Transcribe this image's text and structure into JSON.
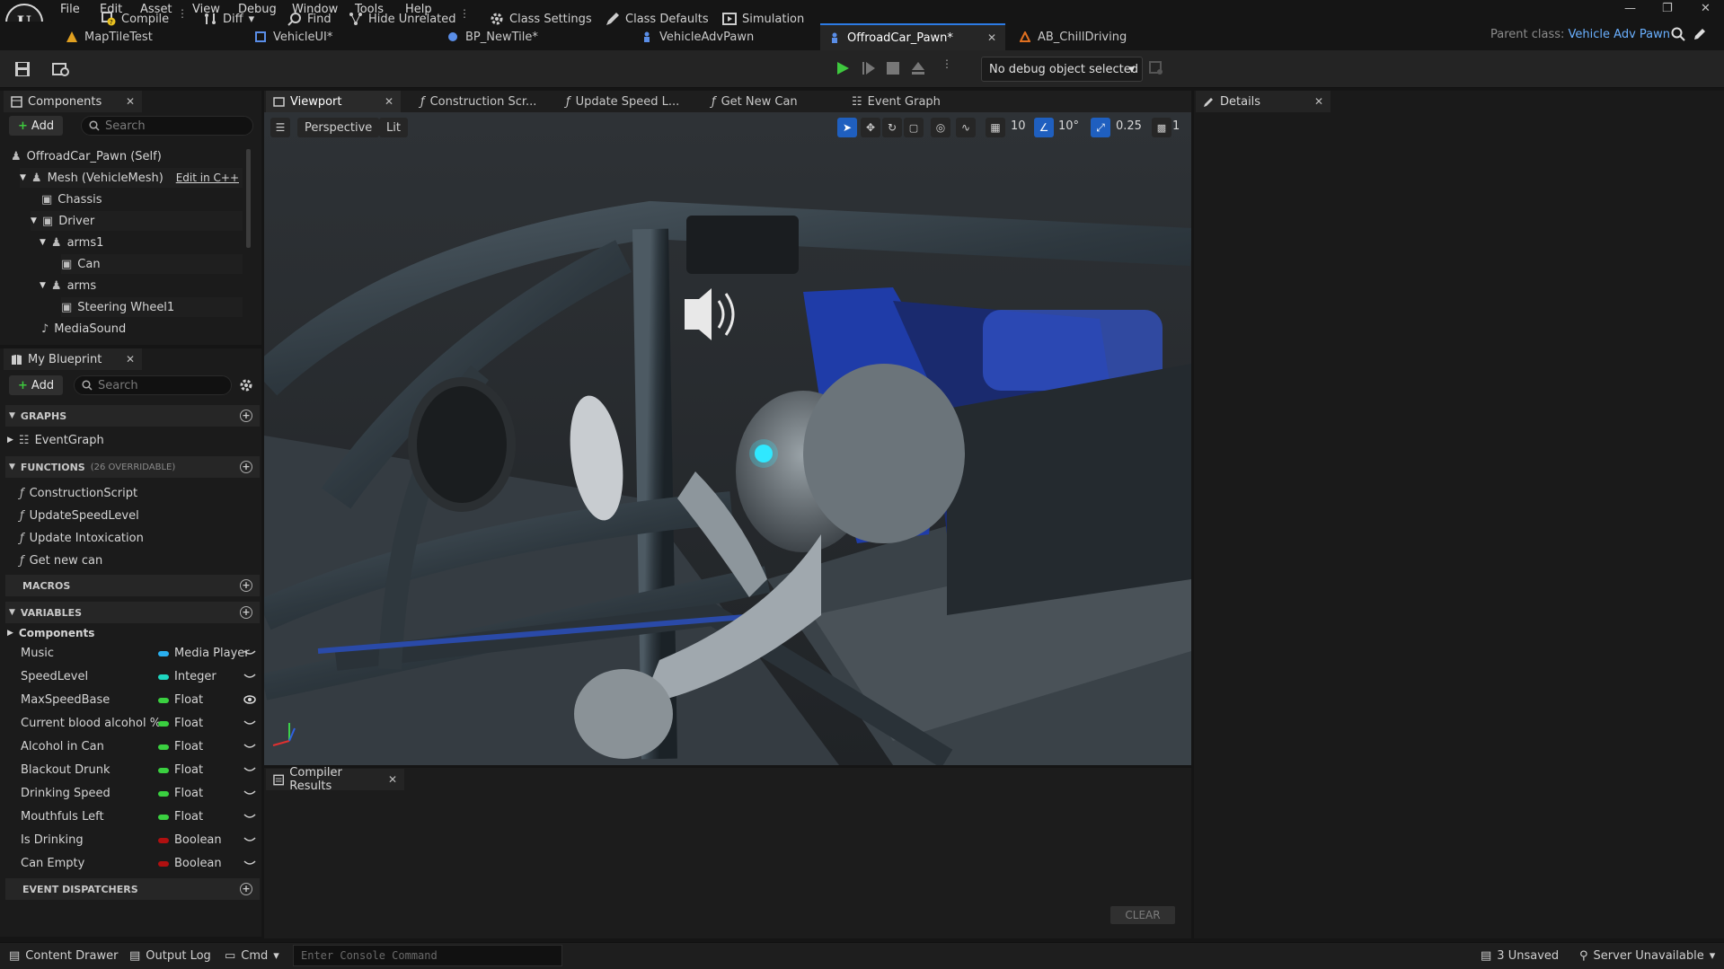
{
  "menu": [
    "File",
    "Edit",
    "Asset",
    "View",
    "Debug",
    "Window",
    "Tools",
    "Help"
  ],
  "doc_tabs": [
    {
      "label": "MapTileTest",
      "color": "#e0a020"
    },
    {
      "label": "VehicleUI*",
      "color": "#5a8ee8"
    },
    {
      "label": "BP_NewTile*",
      "color": "#5a8ee8"
    },
    {
      "label": "VehicleAdvPawn",
      "color": "#5a8ee8"
    },
    {
      "label": "OffroadCar_Pawn*",
      "color": "#5a8ee8"
    },
    {
      "label": "AB_ChillDriving",
      "color": "#e07020"
    }
  ],
  "parent_class": {
    "label": "Parent class:",
    "value": "Vehicle Adv Pawn"
  },
  "toolbar": {
    "compile": "Compile",
    "diff": "Diff",
    "find": "Find",
    "hide_unrelated": "Hide Unrelated",
    "class_settings": "Class Settings",
    "class_defaults": "Class Defaults",
    "simulation": "Simulation",
    "debug_object": "No debug object selected"
  },
  "components_panel": {
    "tab": "Components",
    "add": "Add",
    "search_placeholder": "Search",
    "tree": [
      {
        "label": "OffroadCar_Pawn (Self)",
        "indent": 0
      },
      {
        "label": "Mesh (VehicleMesh)",
        "indent": 1,
        "extra": "Edit in C++"
      },
      {
        "label": "Chassis",
        "indent": 2
      },
      {
        "label": "Driver",
        "indent": 2
      },
      {
        "label": "arms1",
        "indent": 3
      },
      {
        "label": "Can",
        "indent": 4
      },
      {
        "label": "arms",
        "indent": 3
      },
      {
        "label": "Steering Wheel1",
        "indent": 4
      },
      {
        "label": "MediaSound",
        "indent": 2
      }
    ]
  },
  "blueprint_panel": {
    "tab": "My Blueprint",
    "add": "Add",
    "search_placeholder": "Search",
    "graphs_label": "GRAPHS",
    "event_graph": "EventGraph",
    "functions_label": "FUNCTIONS",
    "functions_note": "(26 OVERRIDABLE)",
    "functions": [
      "ConstructionScript",
      "UpdateSpeedLevel",
      "Update Intoxication",
      "Get new can"
    ],
    "macros_label": "MACROS",
    "variables_label": "VARIABLES",
    "components_cat": "Components",
    "variables": [
      {
        "name": "Music",
        "type": "Media Player",
        "color": "#2ab0f0"
      },
      {
        "name": "SpeedLevel",
        "type": "Integer",
        "color": "#1ed6c0"
      },
      {
        "name": "MaxSpeedBase",
        "type": "Float",
        "color": "#3ad040"
      },
      {
        "name": "Current blood alcohol %",
        "type": "Float",
        "color": "#3ad040"
      },
      {
        "name": "Alcohol in Can",
        "type": "Float",
        "color": "#3ad040"
      },
      {
        "name": "Blackout Drunk",
        "type": "Float",
        "color": "#3ad040"
      },
      {
        "name": "Drinking Speed",
        "type": "Float",
        "color": "#3ad040"
      },
      {
        "name": "Mouthfuls Left",
        "type": "Float",
        "color": "#3ad040"
      },
      {
        "name": "Is Drinking",
        "type": "Boolean",
        "color": "#b01010"
      },
      {
        "name": "Can Empty",
        "type": "Boolean",
        "color": "#b01010"
      }
    ],
    "event_dispatchers_label": "EVENT DISPATCHERS"
  },
  "editor_tabs": [
    "Viewport",
    "Construction Scr...",
    "Update Speed L...",
    "Get New Can",
    "Event Graph"
  ],
  "viewport": {
    "perspective": "Perspective",
    "lit": "Lit",
    "grid": "10",
    "angle": "10°",
    "scale": "0.25",
    "camera": "1"
  },
  "compiler": {
    "tab": "Compiler Results",
    "clear": "CLEAR"
  },
  "details": {
    "tab": "Details"
  },
  "statusbar": {
    "content_drawer": "Content Drawer",
    "output_log": "Output Log",
    "cmd": "Cmd",
    "console_placeholder": "Enter Console Command",
    "unsaved": "3 Unsaved",
    "server": "Server Unavailable"
  }
}
